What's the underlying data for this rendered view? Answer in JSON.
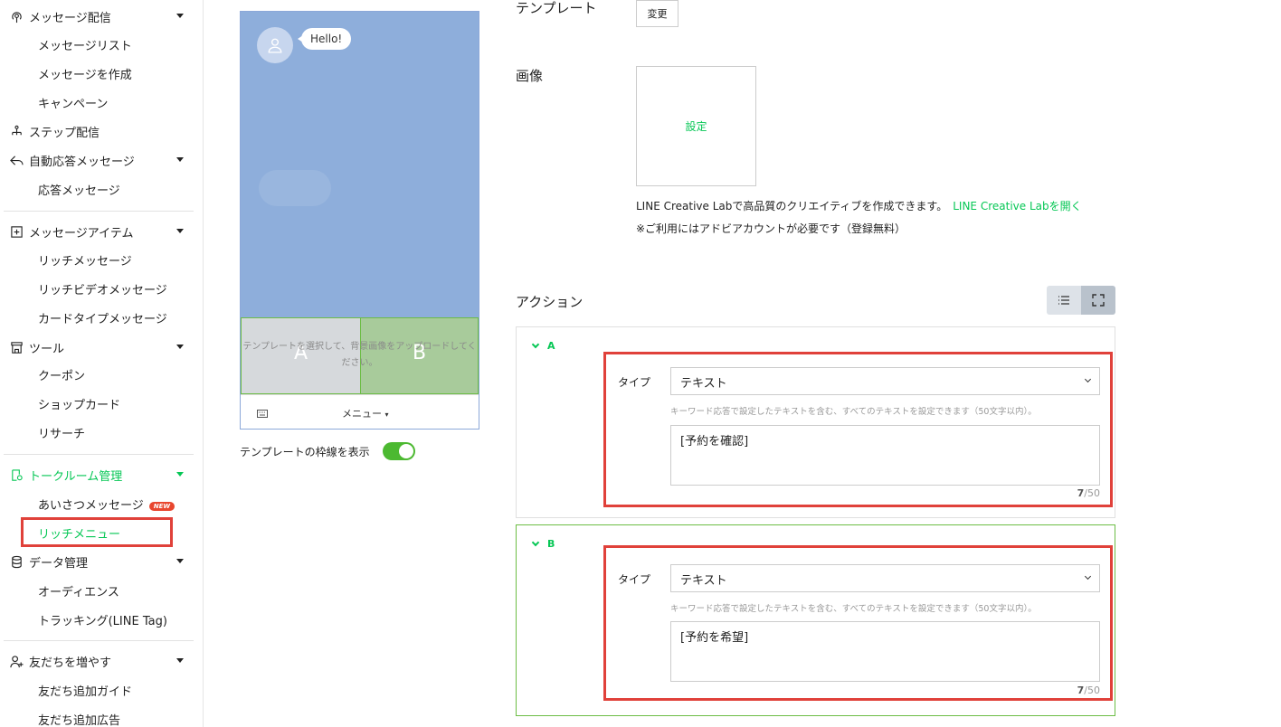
{
  "sidebar": {
    "groups": [
      {
        "label": "メッセージ配信",
        "items": [
          "メッセージリスト",
          "メッセージを作成",
          "キャンペーン"
        ]
      },
      {
        "label": "ステップ配信",
        "items": []
      },
      {
        "label": "自動応答メッセージ",
        "items": [
          "応答メッセージ"
        ]
      },
      {
        "label": "メッセージアイテム",
        "items": [
          "リッチメッセージ",
          "リッチビデオメッセージ",
          "カードタイプメッセージ"
        ]
      },
      {
        "label": "ツール",
        "items": [
          "クーポン",
          "ショップカード",
          "リサーチ"
        ]
      },
      {
        "label": "トークルーム管理",
        "items": [
          "あいさつメッセージ",
          "リッチメニュー"
        ],
        "active": true
      },
      {
        "label": "データ管理",
        "items": [
          "オーディエンス",
          "トラッキング(LINE Tag)"
        ]
      },
      {
        "label": "友だちを増やす",
        "items": [
          "友だち追加ガイド",
          "友だち追加広告"
        ]
      }
    ],
    "new_badge": "NEW",
    "active_item": "リッチメニュー"
  },
  "preview": {
    "bubble_text": "Hello!",
    "hint": "テンプレートを選択して、背景画像をアップロードしてください。",
    "area_a": "A",
    "area_b": "B",
    "menu_label": "メニュー",
    "toggle_label": "テンプレートの枠線を表示",
    "toggle_on": true
  },
  "form": {
    "template_label": "テンプレート",
    "change_button": "変更",
    "image_label": "画像",
    "image_set": "設定",
    "creative_note": "LINE Creative Labで高品質のクリエイティブを作成できます。",
    "creative_link": "LINE Creative Labを開く",
    "adobe_note": "※ご利用にはアドビアカウントが必要です（登録無料）",
    "action_label": "アクション"
  },
  "actions": [
    {
      "key": "A",
      "type_label": "タイプ",
      "type_value": "テキスト",
      "help": "キーワード応答で設定したテキストを含む、すべてのテキストを設定できます（50文字以内）。",
      "text": "[予約を確認]",
      "count": "7",
      "max": "/50"
    },
    {
      "key": "B",
      "type_label": "タイプ",
      "type_value": "テキスト",
      "help": "キーワード応答で設定したテキストを含む、すべてのテキストを設定できます（50文字以内）。",
      "text": "[予約を希望]",
      "count": "7",
      "max": "/50"
    }
  ],
  "colors": {
    "accent": "#06c755",
    "highlight": "#e0413a",
    "preview_bg": "#8eaedb"
  }
}
